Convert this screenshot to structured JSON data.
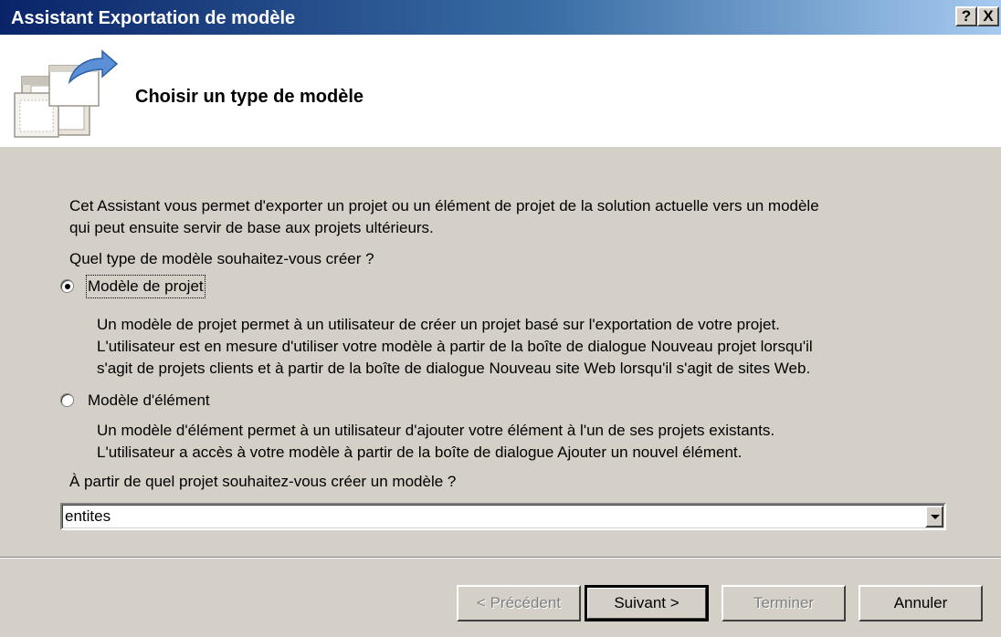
{
  "window": {
    "title": "Assistant Exportation de modèle",
    "help_button": "?",
    "close_button": "X"
  },
  "header": {
    "title": "Choisir un type de modèle",
    "icon": "wizard-export-icon"
  },
  "body": {
    "intro_line1": "Cet Assistant vous permet d'exporter un projet ou un élément de projet de la solution actuelle vers un modèle",
    "intro_line2": "qui peut ensuite servir de base aux projets ultérieurs.",
    "question": "Quel type de modèle souhaitez-vous créer ?",
    "options": [
      {
        "label": "Modèle de projet",
        "selected": true,
        "desc_lines": [
          "Un modèle de projet permet à un utilisateur de créer un projet basé sur l'exportation de votre projet.",
          "L'utilisateur est en mesure d'utiliser votre modèle à partir de la boîte de dialogue Nouveau projet lorsqu'il",
          "s'agit de projets clients et à partir de la boîte de dialogue Nouveau site Web lorsqu'il s'agit de sites Web."
        ]
      },
      {
        "label": "Modèle d'élément",
        "selected": false,
        "desc_lines": [
          "Un modèle d'élément permet à un utilisateur d'ajouter votre élément à l'un de ses projets existants.",
          "L'utilisateur a accès à votre modèle à partir de la boîte de dialogue Ajouter un nouvel élément."
        ]
      }
    ],
    "project_question": "À partir de quel projet souhaitez-vous créer un modèle ?",
    "project_combo_value": "entites"
  },
  "footer": {
    "previous_label": "< Précédent",
    "next_label": "Suivant >",
    "finish_label": "Terminer",
    "cancel_label": "Annuler"
  }
}
